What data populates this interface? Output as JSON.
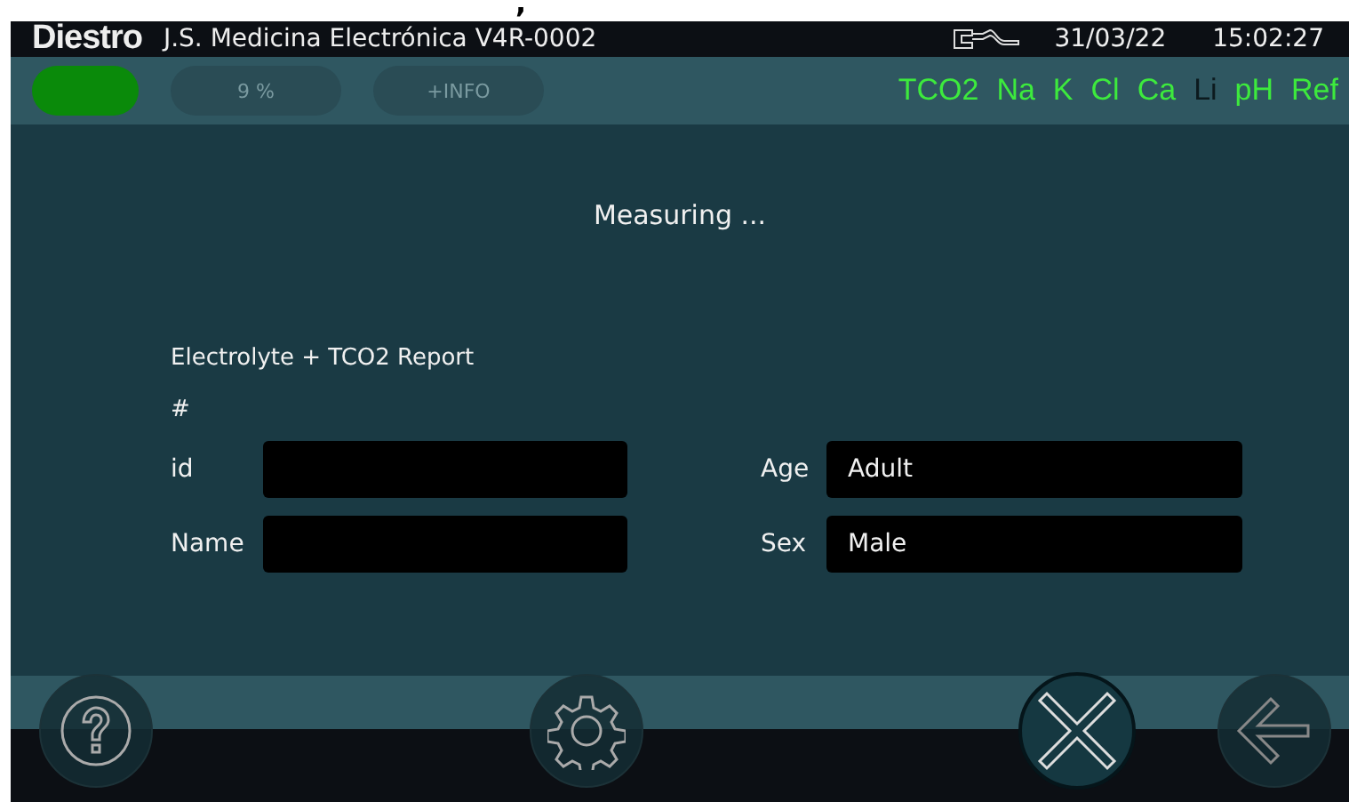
{
  "stray_mark": ",",
  "title_bar": {
    "logo": "Diestro",
    "title": "J.S. Medicina Electrónica V4R-0002",
    "date": "31/03/22",
    "time": "15:02:27"
  },
  "toolbar": {
    "status_indicator": {
      "color": "#0a8a0a"
    },
    "progress": "9 %",
    "info": "+INFO",
    "analytes": [
      {
        "label": "TCO2",
        "active": true
      },
      {
        "label": "Na",
        "active": true
      },
      {
        "label": "K",
        "active": true
      },
      {
        "label": "Cl",
        "active": true
      },
      {
        "label": "Ca",
        "active": true
      },
      {
        "label": "Li",
        "active": false
      },
      {
        "label": "pH",
        "active": true
      },
      {
        "label": "Ref",
        "active": true
      }
    ]
  },
  "message": "Measuring ...",
  "report": {
    "title": "Electrolyte + TCO2 Report",
    "number_label": "#",
    "fields": [
      {
        "label": "id"
      },
      {
        "label": "Age",
        "value": "Adult"
      },
      {
        "label": "Name"
      },
      {
        "label": "Sex",
        "value": "Male"
      }
    ]
  },
  "bottom_buttons": [
    {
      "kind": "help",
      "selected": false
    },
    {
      "kind": "settings",
      "selected": false
    },
    {
      "kind": "cancel",
      "selected": true
    },
    {
      "kind": "back",
      "selected": false
    }
  ]
}
